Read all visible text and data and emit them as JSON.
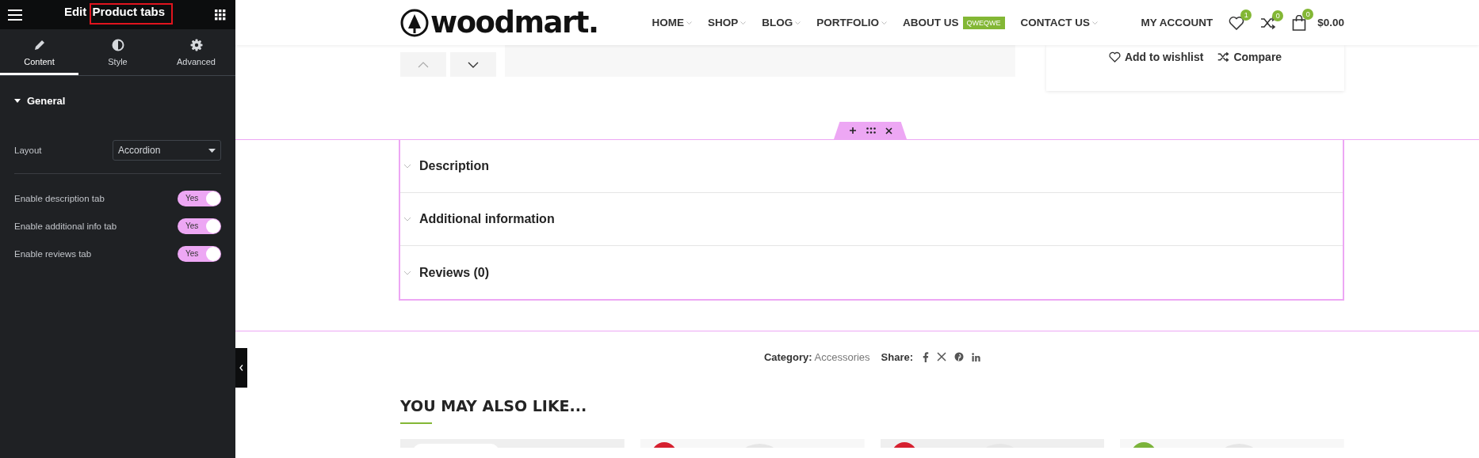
{
  "editor_panel": {
    "title_parts": [
      {
        "text": "Edit",
        "highlighted": false
      },
      {
        "text": "Product tabs",
        "highlighted": true
      }
    ],
    "tabs": [
      {
        "label": "Content",
        "selected": true
      },
      {
        "label": "Style",
        "selected": false
      },
      {
        "label": "Advanced",
        "selected": false
      }
    ],
    "section": {
      "title": "General",
      "expanded": true
    },
    "layout_field": {
      "label": "Layout",
      "value": "Accordion"
    },
    "toggles": [
      {
        "label": "Enable description tab",
        "on": true,
        "text": "Yes"
      },
      {
        "label": "Enable additional info tab",
        "on": true,
        "text": "Yes"
      },
      {
        "label": "Enable reviews tab",
        "on": true,
        "text": "Yes"
      }
    ]
  },
  "header": {
    "logo": "woodmart.",
    "nav": [
      {
        "label": "HOME",
        "has_dropdown": true
      },
      {
        "label": "SHOP",
        "has_dropdown": true
      },
      {
        "label": "BLOG",
        "has_dropdown": true
      },
      {
        "label": "PORTFOLIO",
        "has_dropdown": true
      },
      {
        "label": "ABOUT US",
        "has_dropdown": false,
        "badge": "QWEQWE"
      },
      {
        "label": "CONTACT US",
        "has_dropdown": true
      }
    ],
    "account": "MY ACCOUNT",
    "icons": [
      {
        "kind": "wishlist",
        "count": "1"
      },
      {
        "kind": "compare",
        "count": "0"
      },
      {
        "kind": "cart",
        "count": "0"
      }
    ],
    "cart_total": "$0.00"
  },
  "product_actions": [
    {
      "kind": "wishlist",
      "label": "Add to wishlist"
    },
    {
      "kind": "compare",
      "label": "Compare"
    }
  ],
  "product_tabs": [
    {
      "title": "Description",
      "expanded": false
    },
    {
      "title": "Additional information",
      "expanded": false
    },
    {
      "title": "Reviews (0)",
      "expanded": false
    }
  ],
  "meta": {
    "category_label": "Category:",
    "category": "Accessories",
    "share_label": "Share:"
  },
  "related": {
    "title": "YOU MAY ALSO LIKE..."
  }
}
